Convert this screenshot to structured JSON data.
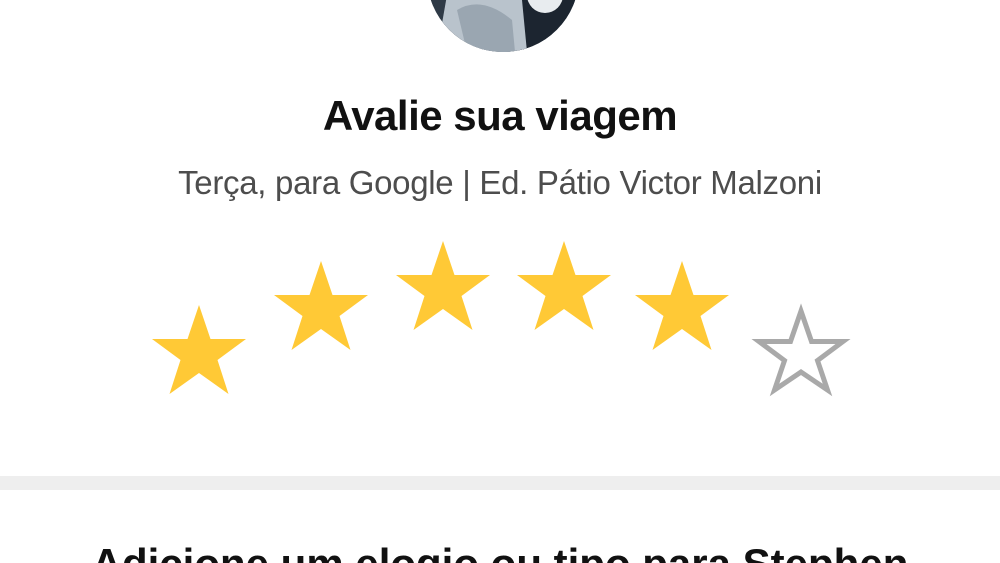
{
  "header": {
    "title": "Avalie sua viagem",
    "subtitle": "Terça, para Google | Ed. Pátio Victor Malzoni"
  },
  "rating": {
    "value": 5,
    "max": 6,
    "filled_color": "#FFC936",
    "empty_color": "#A9A9A9"
  },
  "section": {
    "heading": "Adicione um elogio ou tipo para Stephen"
  },
  "icons": {
    "star_filled": "star-filled-icon",
    "star_empty": "star-outline-icon"
  }
}
